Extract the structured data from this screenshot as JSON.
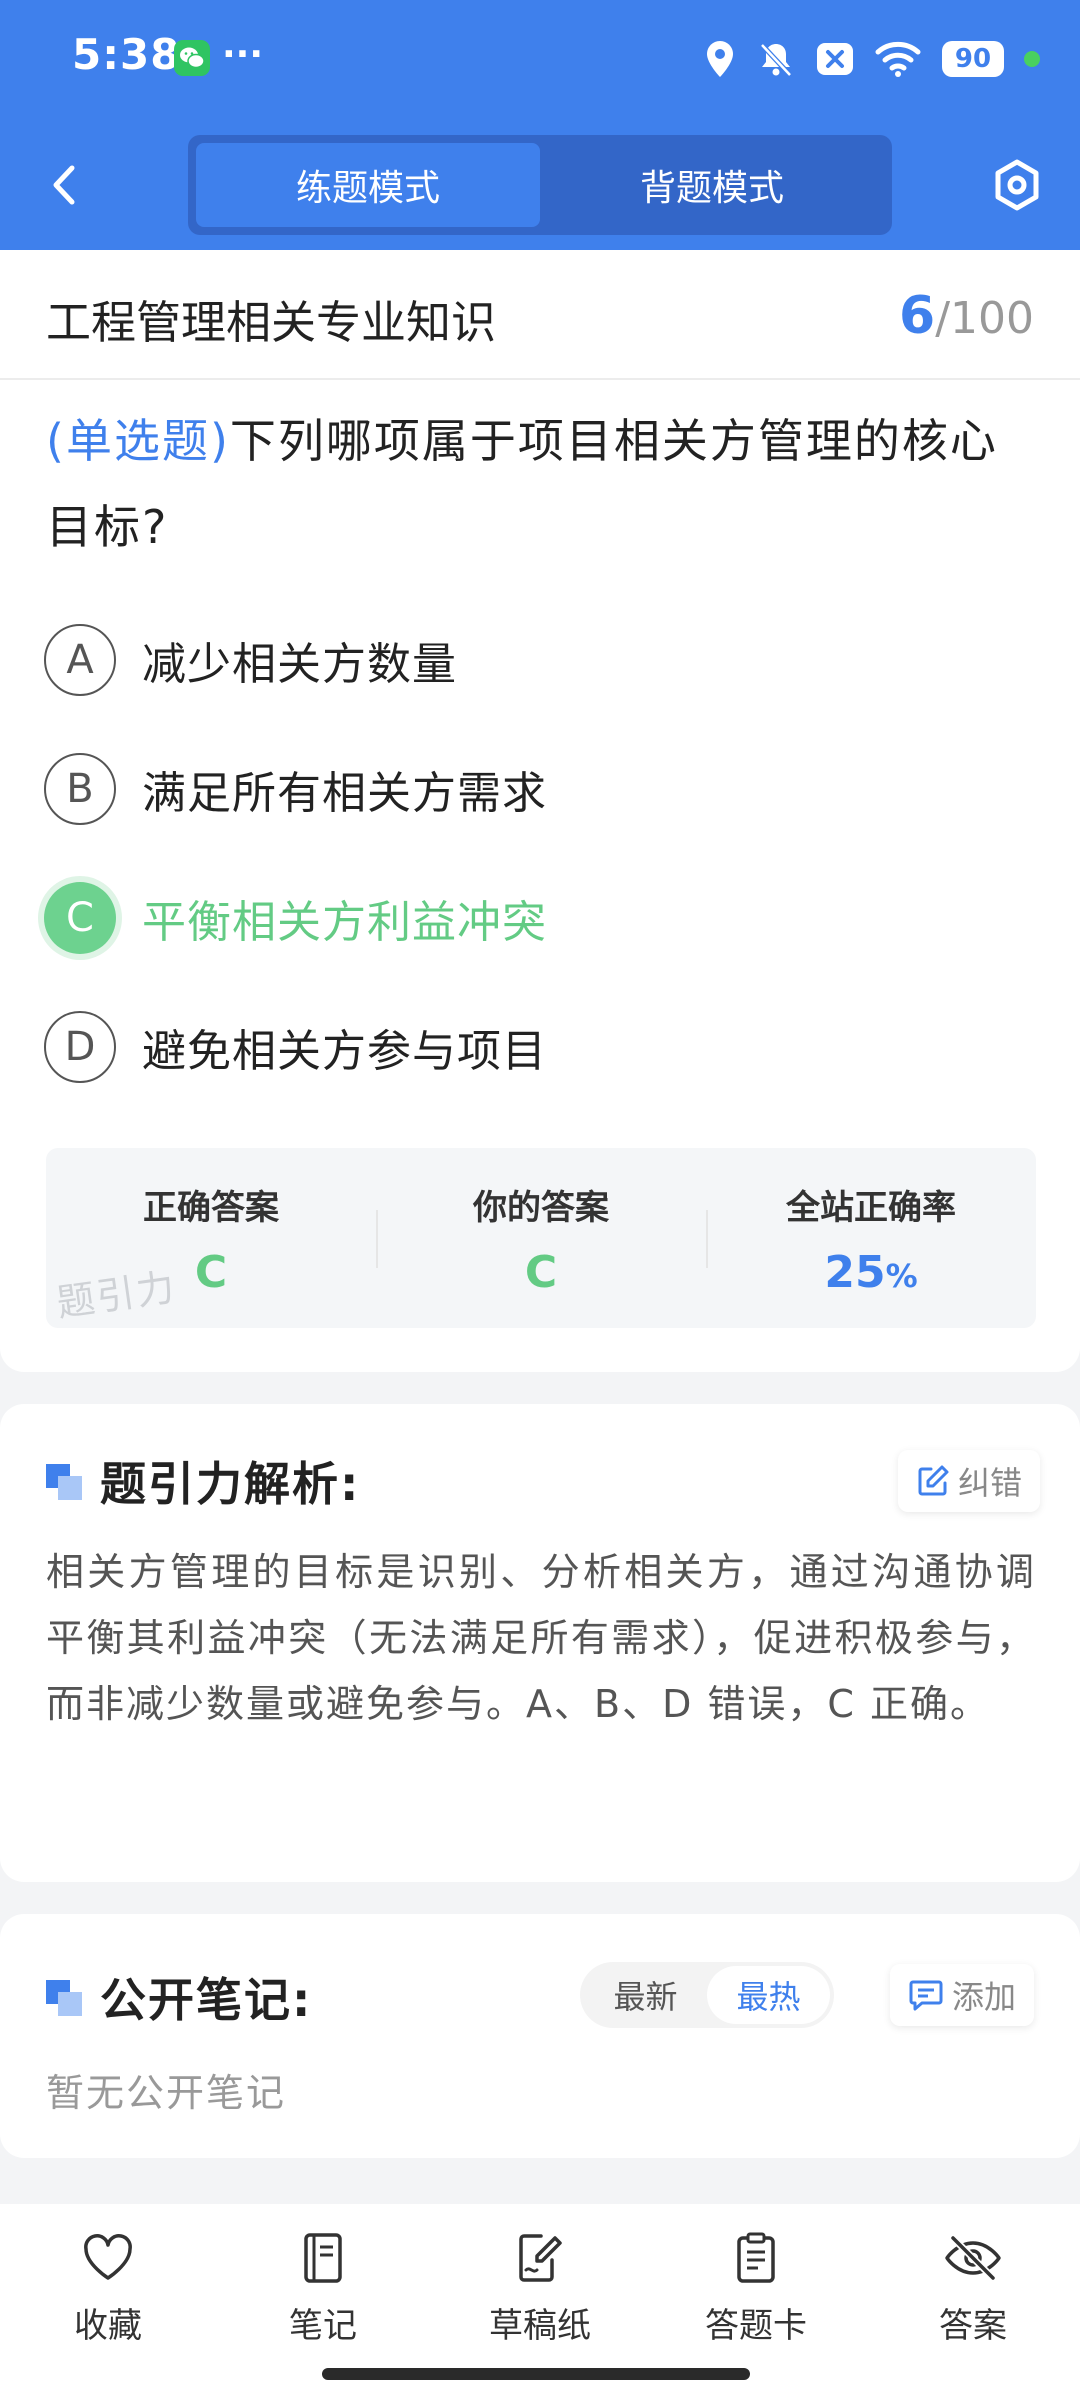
{
  "status_bar": {
    "time": "5:38",
    "more": "···",
    "battery": "90"
  },
  "header": {
    "tabs": [
      {
        "label": "练题模式",
        "active": true
      },
      {
        "label": "背题模式",
        "active": false
      }
    ]
  },
  "question": {
    "subject": "工程管理相关专业知识",
    "progress_current": "6",
    "progress_total": "/100",
    "type": "(单选题)",
    "text": "下列哪项属于项目相关方管理的核心目标?",
    "options": [
      {
        "letter": "A",
        "text": "减少相关方数量",
        "state": "normal"
      },
      {
        "letter": "B",
        "text": "满足所有相关方需求",
        "state": "normal"
      },
      {
        "letter": "C",
        "text": "平衡相关方利益冲突",
        "state": "correct"
      },
      {
        "letter": "D",
        "text": "避免相关方参与项目",
        "state": "normal"
      }
    ],
    "results": {
      "correct_label": "正确答案",
      "correct_value": "C",
      "yours_label": "你的答案",
      "yours_value": "C",
      "rate_label": "全站正确率",
      "rate_value": "25",
      "rate_unit": "%"
    },
    "watermark": "题引力"
  },
  "analysis": {
    "title": "题引力解析:",
    "report_label": "纠错",
    "text": "相关方管理的目标是识别、分析相关方，通过沟通协调平衡其利益冲突（无法满足所有需求），促进积极参与，而非减少数量或避免参与。A、B、D 错误，C 正确。"
  },
  "notes": {
    "title": "公开笔记:",
    "tabs": [
      {
        "label": "最新",
        "active": false
      },
      {
        "label": "最热",
        "active": true
      }
    ],
    "add_label": "添加",
    "empty": "暂无公开笔记"
  },
  "bottom_tabs": [
    {
      "label": "收藏",
      "icon": "heart-icon"
    },
    {
      "label": "笔记",
      "icon": "notebook-icon"
    },
    {
      "label": "草稿纸",
      "icon": "draft-paper-icon"
    },
    {
      "label": "答题卡",
      "icon": "answer-card-icon"
    },
    {
      "label": "答案",
      "icon": "eye-off-icon"
    }
  ],
  "colors": {
    "primary": "#3f80ec",
    "correct": "#63cb84",
    "header_tab_track": "#3366c8"
  }
}
